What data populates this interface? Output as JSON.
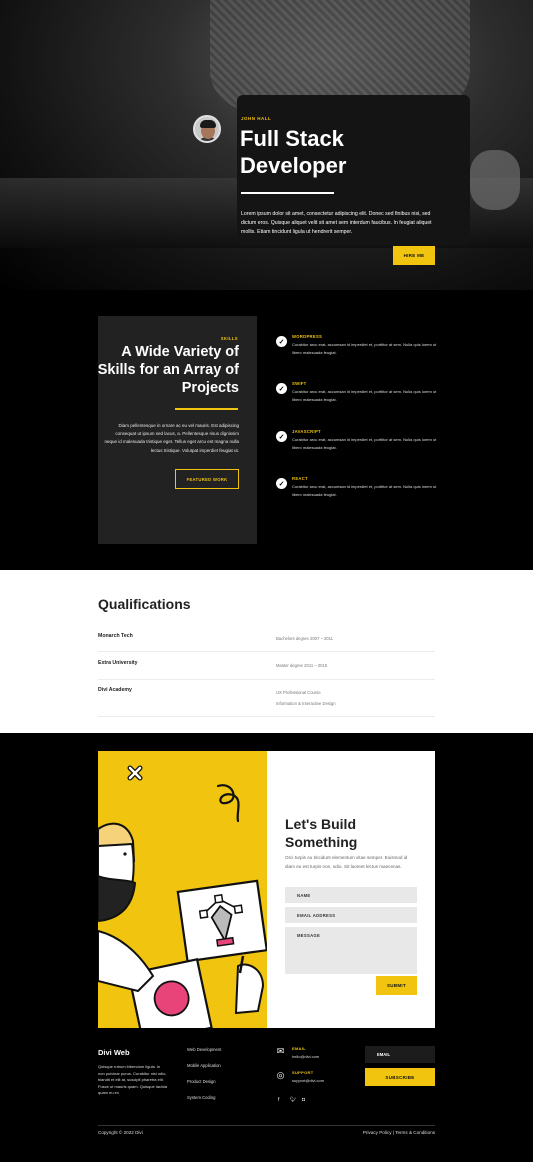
{
  "hero": {
    "name_tag": "JOHN HALL",
    "title_line1": "Full Stack",
    "title_line2": "Developer",
    "intro": "Lorem ipsum dolor sit amet, consectetur adipiscing elit. Donec sed finibus nisi, sed dictum eros. Quisque aliquet velit sit amet sem interdum faucibus. In feugiat aliquet mollis. Etiam tincidunt ligula ut hendrerit semper.",
    "cta_label": "HIRE ME"
  },
  "skills": {
    "tag": "SKILLS",
    "title": "A Wide Variety of Skills for an Array of Projects",
    "text": "Diam pellentesque in ornare ac eu vel mauris. Est adipiscing consequat ut ipsum sed lacus, a. Pellentesque risus dignissim neque id malesuada tristique eget. Tellus eget arcu est magna nulla lectus tristique. Volutpat imperdiet feugiat ut.",
    "button_label": "FEATURED WORK",
    "items": [
      {
        "name": "WORDPRESS",
        "desc": "Curabitur arcu erat, accumsan id imperdiet et, porttitor at sem. Nulla quis lorem ut libero malesuada feugiat."
      },
      {
        "name": "SWIFT",
        "desc": "Curabitur arcu erat, accumsan id imperdiet et, porttitor at sem. Nulla quis lorem ut libero malesuada feugiat."
      },
      {
        "name": "JAVASCRIPT",
        "desc": "Curabitur arcu erat, accumsan id imperdiet et, porttitor at sem. Nulla quis lorem ut libero malesuada feugiat."
      },
      {
        "name": "REACT",
        "desc": "Curabitur arcu erat, accumsan id imperdiet et, porttitor at sem. Nulla quis lorem ut libero malesuada feugiat."
      }
    ]
  },
  "qualifications": {
    "title": "Qualifications",
    "rows": [
      {
        "school": "Monarch Tech",
        "line1": "Bachelors degree 2007 – 2011",
        "line2": ""
      },
      {
        "school": "Extra University",
        "line1": "Master degree 2011 – 2015",
        "line2": ""
      },
      {
        "school": "Divi Academy",
        "line1": "UX Professional Course",
        "line2": "Information & Interactive Design"
      }
    ]
  },
  "contact": {
    "title_line1": "Let's Build",
    "title_line2": "Something",
    "text": "Orci turpis eu tincidunt elementum vitae semper. Euismod id diam eu est turpis non, odio. Sit laoreet lectus maecenas.",
    "name_placeholder": "NAME",
    "email_placeholder": "EMAIL ADDRESS",
    "message_placeholder": "MESSAGE",
    "submit_label": "SUBMIT"
  },
  "footer": {
    "brand": "Divi Web",
    "about": "Quisque rutrum bibendum ligula. In non pulvinar purus. Curabitur nisi odio, blandit et elit at, suscipit pharetra elit. Fusce ut mauris quam. Quisque lacinia quam eu ex",
    "links": [
      "Web Development",
      "Mobile Application",
      "Product Design",
      "System Coding"
    ],
    "email_label": "EMAIL",
    "email_value": "hello@divi.com",
    "support_label": "SUPPORT",
    "support_value": "support@divi.com",
    "newsletter_placeholder": "EMAIL",
    "subscribe_label": "SUBSCRIBE",
    "copyright": "Copyright © 2022 Divi",
    "legal": "Privacy Policy | Terms & Conditions"
  },
  "colors": {
    "accent": "#f0c40f",
    "dark_card": "#222222",
    "background": "#000000"
  },
  "icons": [
    "check-icon",
    "envelope-icon",
    "lifebuoy-icon",
    "facebook-icon",
    "twitter-icon",
    "instagram-icon"
  ]
}
